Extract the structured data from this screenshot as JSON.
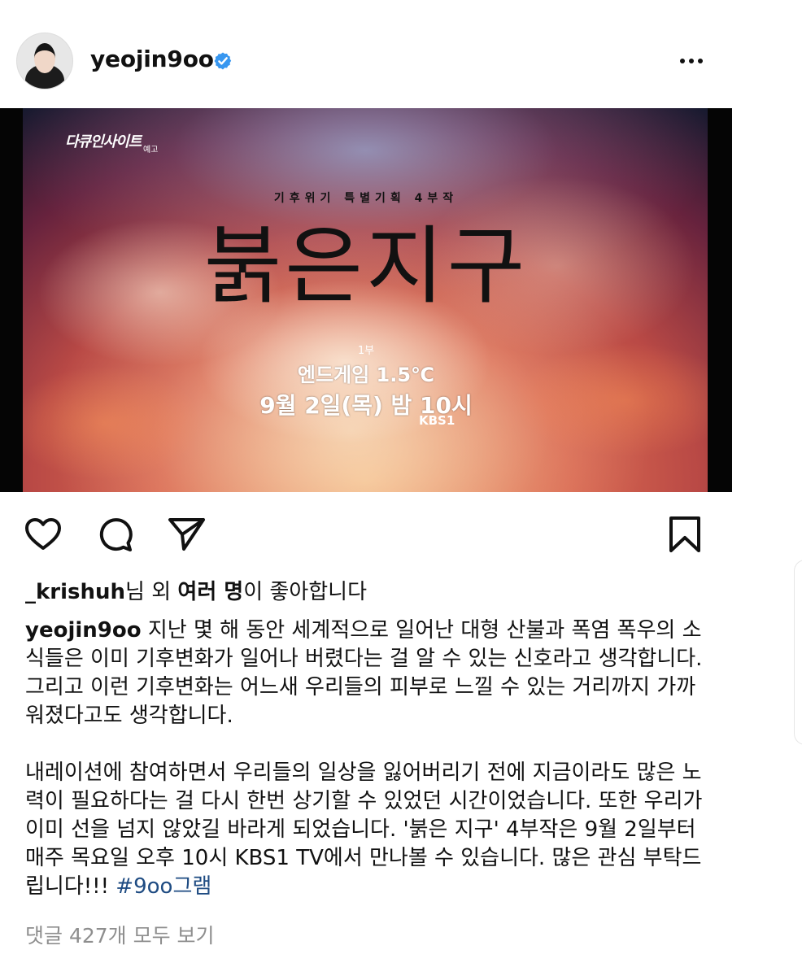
{
  "post": {
    "username": "yeojin9oo",
    "media": {
      "logo_text": "다큐인사이트",
      "logo_suffix": "예고",
      "subtitle": "기후위기 특별기획 4부작",
      "main_title": "붉은지구",
      "episode_number": "1부",
      "episode_title": "엔드게임 1.5℃",
      "air_time": "9월 2일(목) 밤 10시",
      "network": "KBS1"
    },
    "likes": {
      "user": "_krishuh",
      "middle": "님 외 ",
      "many": "여러 명",
      "tail": "이 좋아합니다"
    },
    "caption": {
      "author": "yeojin9oo",
      "text": " 지난 몇 해 동안 세계적으로 일어난 대형 산불과 폭염 폭우의 소식들은 이미 기후변화가 일어나 버렸다는 걸 알 수 있는 신호라고 생각합니다. 그리고 이런 기후변화는 어느새 우리들의 피부로 느낄 수 있는 거리까지 가까워졌다고도 생각합니다.\n\n내레이션에 참여하면서 우리들의 일상을 잃어버리기 전에 지금이라도 많은 노력이 필요하다는 걸 다시 한번 상기할 수 있었던 시간이었습니다. 또한 우리가 이미 선을 넘지 않았길 바라게 되었습니다. '붉은 지구' 4부작은 9월 2일부터 매주 목요일 오후 10시 KBS1 TV에서 만나볼 수 있습니다. 많은 관심 부탁드립니다!!! ",
      "hashtag": "#9oo그램"
    },
    "comments_link": "댓글 427개 모두 보기"
  },
  "icons": {
    "verified": "verified-badge-icon",
    "more": "more-options-icon",
    "like": "heart-icon",
    "comment": "comment-bubble-icon",
    "share": "paper-plane-icon",
    "save": "bookmark-icon"
  },
  "colors": {
    "verified": "#3897f0",
    "hashtag": "#1e4b82",
    "muted": "#8e8e8e"
  }
}
